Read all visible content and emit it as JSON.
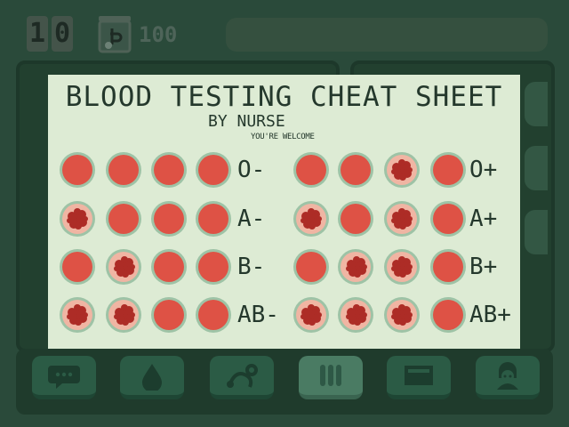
{
  "hud": {
    "day_digits": [
      "1",
      "0"
    ],
    "money": "100",
    "jar_icon": "cash-jar-icon"
  },
  "cheat_sheet": {
    "title": "BLOOD TESTING CHEAT SHEET",
    "byline": "BY NURSE",
    "note": "YOU'RE WELCOME",
    "groups": [
      {
        "label": "O-",
        "wells": [
          "solid",
          "solid",
          "solid",
          "solid"
        ]
      },
      {
        "label": "A-",
        "wells": [
          "clotted",
          "solid",
          "solid",
          "solid"
        ]
      },
      {
        "label": "B-",
        "wells": [
          "solid",
          "clotted",
          "solid",
          "solid"
        ]
      },
      {
        "label": "AB-",
        "wells": [
          "clotted",
          "clotted",
          "solid",
          "solid"
        ]
      },
      {
        "label": "O+",
        "wells": [
          "solid",
          "solid",
          "clotted",
          "solid"
        ]
      },
      {
        "label": "A+",
        "wells": [
          "clotted",
          "solid",
          "clotted",
          "solid"
        ]
      },
      {
        "label": "B+",
        "wells": [
          "solid",
          "clotted",
          "clotted",
          "solid"
        ]
      },
      {
        "label": "AB+",
        "wells": [
          "clotted",
          "clotted",
          "clotted",
          "solid"
        ]
      }
    ]
  },
  "toolbar": {
    "selected": "test-tubes",
    "tools": [
      {
        "id": "chat",
        "icon": "speech-bubble-icon"
      },
      {
        "id": "blood",
        "icon": "blood-drop-icon"
      },
      {
        "id": "stethoscope",
        "icon": "stethoscope-icon"
      },
      {
        "id": "test-tubes",
        "icon": "test-tubes-icon"
      },
      {
        "id": "tray",
        "icon": "tray-icon"
      },
      {
        "id": "patient",
        "icon": "nurse-icon"
      }
    ]
  },
  "colors": {
    "background": "#2a4a3a",
    "sheet": "#ddebd4",
    "ink": "#24382c",
    "blood": "#de5245",
    "clot": "#ad2c26",
    "well_rim": "#9ec3a6",
    "agglutinated_bg": "#f0b5a3"
  }
}
